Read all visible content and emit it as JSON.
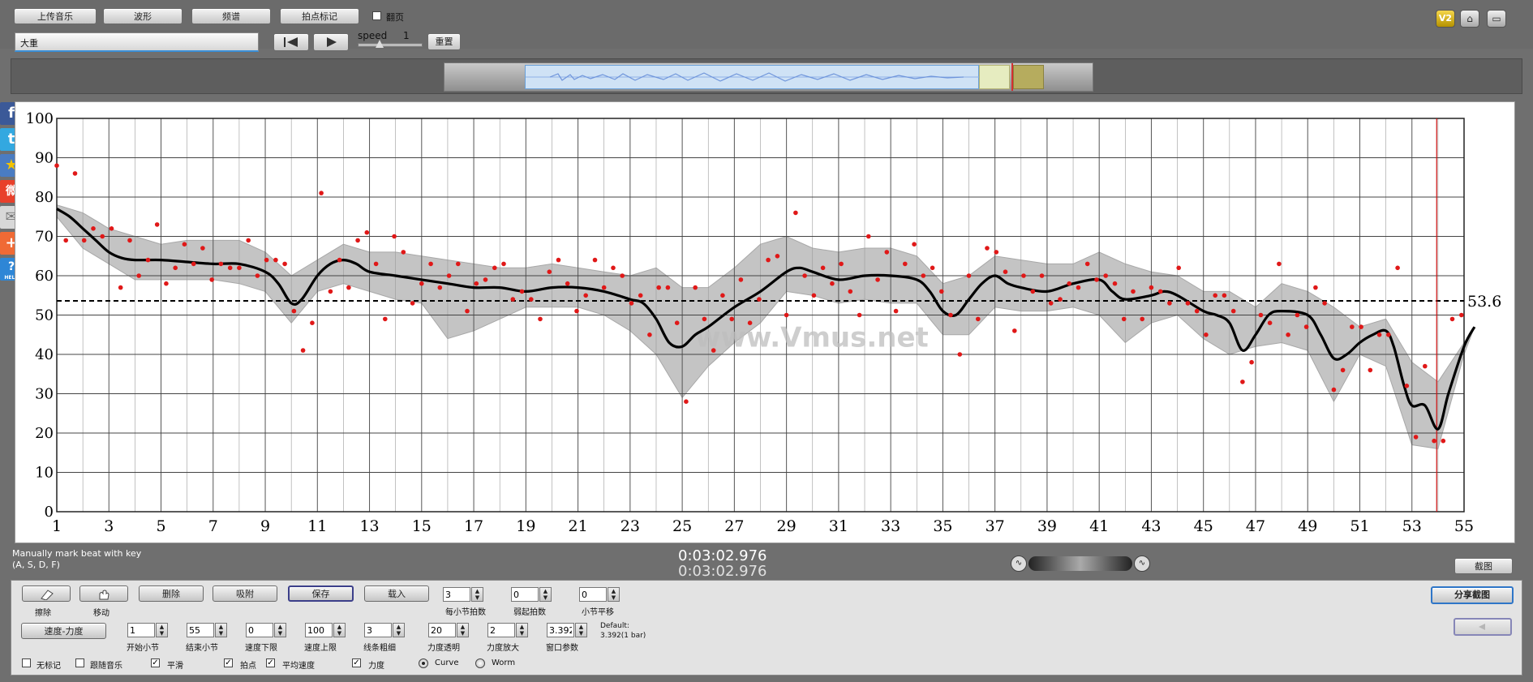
{
  "toolbar": {
    "upload": "上传音乐",
    "waveform": "波形",
    "spectrum": "频谱",
    "beat_mark": "拍点标记",
    "flip_page": "翻页",
    "song_title": "大重",
    "speed_label": "speed",
    "speed_value": "1",
    "reset": "重置"
  },
  "top_icons": [
    "v2-icon",
    "home-icon",
    "window-icon"
  ],
  "chart_data": {
    "type": "scatter",
    "xlim": [
      1,
      55
    ],
    "ylim": [
      0,
      100
    ],
    "x_ticks": [
      1,
      3,
      5,
      7,
      9,
      11,
      13,
      15,
      17,
      19,
      21,
      23,
      25,
      27,
      29,
      31,
      33,
      35,
      37,
      39,
      41,
      43,
      45,
      47,
      49,
      51,
      53,
      55
    ],
    "y_ticks": [
      0,
      10,
      20,
      30,
      40,
      50,
      60,
      70,
      80,
      90,
      100
    ],
    "average": 53.6,
    "average_label": "53.6",
    "cursor_x": 53.95,
    "watermark": "www.Vmus.net",
    "points": [
      [
        1,
        88
      ],
      [
        1.35,
        69
      ],
      [
        1.7,
        86
      ],
      [
        2.05,
        69
      ],
      [
        2.4,
        72
      ],
      [
        2.75,
        70
      ],
      [
        3.1,
        72
      ],
      [
        3.45,
        57
      ],
      [
        3.8,
        69
      ],
      [
        4.15,
        60
      ],
      [
        4.5,
        64
      ],
      [
        4.85,
        73
      ],
      [
        5.2,
        58
      ],
      [
        5.55,
        62
      ],
      [
        5.9,
        68
      ],
      [
        6.25,
        63
      ],
      [
        6.6,
        67
      ],
      [
        6.95,
        59
      ],
      [
        7.3,
        63
      ],
      [
        7.65,
        62
      ],
      [
        8.0,
        62
      ],
      [
        8.35,
        69
      ],
      [
        8.7,
        60
      ],
      [
        9.05,
        64
      ],
      [
        9.4,
        64
      ],
      [
        9.75,
        63
      ],
      [
        10.1,
        51
      ],
      [
        10.45,
        41
      ],
      [
        10.8,
        48
      ],
      [
        11.15,
        81
      ],
      [
        11.5,
        56
      ],
      [
        11.85,
        64
      ],
      [
        12.2,
        57
      ],
      [
        12.55,
        69
      ],
      [
        12.9,
        71
      ],
      [
        13.25,
        63
      ],
      [
        13.6,
        49
      ],
      [
        13.95,
        70
      ],
      [
        14.3,
        66
      ],
      [
        14.65,
        53
      ],
      [
        15.0,
        58
      ],
      [
        15.35,
        63
      ],
      [
        15.7,
        57
      ],
      [
        16.05,
        60
      ],
      [
        16.4,
        63
      ],
      [
        16.75,
        51
      ],
      [
        17.1,
        58
      ],
      [
        17.45,
        59
      ],
      [
        17.8,
        62
      ],
      [
        18.15,
        63
      ],
      [
        18.5,
        54
      ],
      [
        18.85,
        56
      ],
      [
        19.2,
        54
      ],
      [
        19.55,
        49
      ],
      [
        19.9,
        61
      ],
      [
        20.25,
        64
      ],
      [
        20.6,
        58
      ],
      [
        20.95,
        51
      ],
      [
        21.3,
        55
      ],
      [
        21.65,
        64
      ],
      [
        22.0,
        57
      ],
      [
        22.35,
        62
      ],
      [
        22.7,
        60
      ],
      [
        23.05,
        53
      ],
      [
        23.4,
        55
      ],
      [
        23.75,
        45
      ],
      [
        24.1,
        57
      ],
      [
        24.45,
        57
      ],
      [
        24.8,
        48
      ],
      [
        25.15,
        28
      ],
      [
        25.5,
        57
      ],
      [
        25.85,
        49
      ],
      [
        26.2,
        41
      ],
      [
        26.55,
        55
      ],
      [
        26.9,
        49
      ],
      [
        27.25,
        59
      ],
      [
        27.6,
        48
      ],
      [
        27.95,
        54
      ],
      [
        28.3,
        64
      ],
      [
        28.65,
        65
      ],
      [
        29.0,
        50
      ],
      [
        29.35,
        76
      ],
      [
        29.7,
        60
      ],
      [
        30.05,
        55
      ],
      [
        30.4,
        62
      ],
      [
        30.75,
        58
      ],
      [
        31.1,
        63
      ],
      [
        31.45,
        56
      ],
      [
        31.8,
        50
      ],
      [
        32.15,
        70
      ],
      [
        32.5,
        59
      ],
      [
        32.85,
        66
      ],
      [
        33.2,
        51
      ],
      [
        33.55,
        63
      ],
      [
        33.9,
        68
      ],
      [
        34.25,
        60
      ],
      [
        34.6,
        62
      ],
      [
        34.95,
        56
      ],
      [
        35.3,
        50
      ],
      [
        35.65,
        40
      ],
      [
        36.0,
        60
      ],
      [
        36.35,
        49
      ],
      [
        36.7,
        67
      ],
      [
        37.05,
        66
      ],
      [
        37.4,
        61
      ],
      [
        37.75,
        46
      ],
      [
        38.1,
        60
      ],
      [
        38.45,
        56
      ],
      [
        38.8,
        60
      ],
      [
        39.15,
        53
      ],
      [
        39.5,
        54
      ],
      [
        39.85,
        58
      ],
      [
        40.2,
        57
      ],
      [
        40.55,
        63
      ],
      [
        40.9,
        59
      ],
      [
        41.25,
        60
      ],
      [
        41.6,
        58
      ],
      [
        41.95,
        49
      ],
      [
        42.3,
        56
      ],
      [
        42.65,
        49
      ],
      [
        43.0,
        57
      ],
      [
        43.35,
        56
      ],
      [
        43.7,
        53
      ],
      [
        44.05,
        62
      ],
      [
        44.4,
        53
      ],
      [
        44.75,
        51
      ],
      [
        45.1,
        45
      ],
      [
        45.45,
        55
      ],
      [
        45.8,
        55
      ],
      [
        46.15,
        51
      ],
      [
        46.5,
        33
      ],
      [
        46.85,
        38
      ],
      [
        47.2,
        50
      ],
      [
        47.55,
        48
      ],
      [
        47.9,
        63
      ],
      [
        48.25,
        45
      ],
      [
        48.6,
        50
      ],
      [
        48.95,
        47
      ],
      [
        49.3,
        57
      ],
      [
        49.65,
        53
      ],
      [
        50.0,
        31
      ],
      [
        50.35,
        36
      ],
      [
        50.7,
        47
      ],
      [
        51.05,
        47
      ],
      [
        51.4,
        36
      ],
      [
        51.75,
        45
      ],
      [
        52.1,
        45
      ],
      [
        52.45,
        62
      ],
      [
        52.8,
        32
      ],
      [
        53.15,
        19
      ],
      [
        53.5,
        37
      ],
      [
        53.85,
        18
      ],
      [
        54.2,
        18
      ],
      [
        54.55,
        49
      ],
      [
        54.9,
        50
      ]
    ],
    "smooth_curve": [
      [
        1,
        77
      ],
      [
        1.5,
        75
      ],
      [
        2,
        72
      ],
      [
        2.5,
        69
      ],
      [
        3,
        66
      ],
      [
        3.5,
        64.5
      ],
      [
        4,
        64
      ],
      [
        5,
        64
      ],
      [
        6,
        63.5
      ],
      [
        7,
        63
      ],
      [
        8,
        63
      ],
      [
        9,
        61
      ],
      [
        9.5,
        58
      ],
      [
        10,
        53
      ],
      [
        10.4,
        54
      ],
      [
        11,
        60
      ],
      [
        11.5,
        63
      ],
      [
        12,
        64
      ],
      [
        12.5,
        63
      ],
      [
        13,
        61
      ],
      [
        14,
        60
      ],
      [
        15,
        59
      ],
      [
        16,
        58
      ],
      [
        17,
        57
      ],
      [
        18,
        57
      ],
      [
        19,
        56
      ],
      [
        20,
        57
      ],
      [
        21,
        57
      ],
      [
        22,
        56
      ],
      [
        23,
        54
      ],
      [
        23.5,
        53
      ],
      [
        24,
        49
      ],
      [
        24.5,
        43
      ],
      [
        25,
        42
      ],
      [
        25.5,
        45
      ],
      [
        26,
        47
      ],
      [
        27,
        52
      ],
      [
        28,
        56
      ],
      [
        29,
        61
      ],
      [
        29.5,
        62
      ],
      [
        30,
        61
      ],
      [
        31,
        59
      ],
      [
        32,
        60
      ],
      [
        33,
        60
      ],
      [
        34,
        59
      ],
      [
        34.5,
        56
      ],
      [
        35,
        51
      ],
      [
        35.5,
        50
      ],
      [
        36,
        54
      ],
      [
        36.5,
        58
      ],
      [
        37,
        60
      ],
      [
        37.5,
        58
      ],
      [
        38,
        57
      ],
      [
        39,
        56
      ],
      [
        40,
        58
      ],
      [
        41,
        59
      ],
      [
        41.5,
        56
      ],
      [
        42,
        54
      ],
      [
        43,
        55
      ],
      [
        43.5,
        56
      ],
      [
        44,
        55
      ],
      [
        45,
        51
      ],
      [
        45.5,
        50
      ],
      [
        46,
        48
      ],
      [
        46.5,
        41
      ],
      [
        47,
        45
      ],
      [
        47.5,
        50
      ],
      [
        48,
        51
      ],
      [
        49,
        50
      ],
      [
        49.5,
        45
      ],
      [
        50,
        39
      ],
      [
        50.5,
        40
      ],
      [
        51,
        43
      ],
      [
        51.5,
        45
      ],
      [
        52,
        46
      ],
      [
        52.3,
        42
      ],
      [
        52.7,
        32
      ],
      [
        53,
        27
      ],
      [
        53.5,
        27
      ],
      [
        54,
        21
      ],
      [
        54.4,
        30
      ],
      [
        55,
        42
      ],
      [
        55.4,
        47
      ]
    ],
    "band_upper": [
      [
        1,
        78
      ],
      [
        2,
        76
      ],
      [
        3,
        72
      ],
      [
        4,
        70
      ],
      [
        5,
        68
      ],
      [
        6,
        69
      ],
      [
        7,
        69
      ],
      [
        8,
        69
      ],
      [
        9,
        66
      ],
      [
        10,
        60
      ],
      [
        11,
        64
      ],
      [
        12,
        68
      ],
      [
        13,
        66
      ],
      [
        14,
        66
      ],
      [
        15,
        65
      ],
      [
        16,
        64
      ],
      [
        17,
        63
      ],
      [
        18,
        62
      ],
      [
        19,
        62
      ],
      [
        20,
        63
      ],
      [
        21,
        62
      ],
      [
        22,
        61
      ],
      [
        23,
        60
      ],
      [
        24,
        62
      ],
      [
        25,
        57
      ],
      [
        26,
        57
      ],
      [
        27,
        62
      ],
      [
        28,
        68
      ],
      [
        29,
        70
      ],
      [
        30,
        67
      ],
      [
        31,
        66
      ],
      [
        32,
        67
      ],
      [
        33,
        67
      ],
      [
        34,
        65
      ],
      [
        35,
        58
      ],
      [
        36,
        60
      ],
      [
        37,
        65
      ],
      [
        38,
        64
      ],
      [
        39,
        63
      ],
      [
        40,
        63
      ],
      [
        41,
        66
      ],
      [
        42,
        63
      ],
      [
        43,
        61
      ],
      [
        44,
        60
      ],
      [
        45,
        56
      ],
      [
        46,
        56
      ],
      [
        47,
        52
      ],
      [
        48,
        58
      ],
      [
        49,
        56
      ],
      [
        50,
        52
      ],
      [
        51,
        47
      ],
      [
        52,
        49
      ],
      [
        53,
        38
      ],
      [
        54,
        33
      ],
      [
        55,
        43
      ],
      [
        55.4,
        47
      ]
    ],
    "band_lower": [
      [
        55.4,
        47
      ],
      [
        55,
        40
      ],
      [
        54,
        16
      ],
      [
        53,
        17
      ],
      [
        52,
        37
      ],
      [
        51,
        40
      ],
      [
        50,
        28
      ],
      [
        49,
        41
      ],
      [
        48,
        43
      ],
      [
        47,
        42
      ],
      [
        46,
        40
      ],
      [
        45,
        44
      ],
      [
        44,
        50
      ],
      [
        43,
        48
      ],
      [
        42,
        43
      ],
      [
        41,
        50
      ],
      [
        40,
        52
      ],
      [
        39,
        51
      ],
      [
        38,
        51
      ],
      [
        37,
        52
      ],
      [
        36,
        45
      ],
      [
        35,
        45
      ],
      [
        34,
        53
      ],
      [
        33,
        53
      ],
      [
        32,
        54
      ],
      [
        31,
        53
      ],
      [
        30,
        55
      ],
      [
        29,
        56
      ],
      [
        28,
        48
      ],
      [
        27,
        43
      ],
      [
        26,
        37
      ],
      [
        25,
        29
      ],
      [
        24,
        40
      ],
      [
        23,
        46
      ],
      [
        22,
        50
      ],
      [
        21,
        52
      ],
      [
        20,
        52
      ],
      [
        19,
        52
      ],
      [
        18,
        49
      ],
      [
        17,
        46
      ],
      [
        16,
        44
      ],
      [
        15,
        53
      ],
      [
        14,
        54
      ],
      [
        13,
        56
      ],
      [
        12,
        58
      ],
      [
        11,
        56
      ],
      [
        10,
        48
      ],
      [
        9,
        56
      ],
      [
        8,
        58
      ],
      [
        7,
        59
      ],
      [
        6,
        59
      ],
      [
        5,
        59
      ],
      [
        4,
        59
      ],
      [
        3,
        63
      ],
      [
        2,
        67
      ],
      [
        1,
        75
      ]
    ]
  },
  "status": {
    "hint_line1": "Manually mark beat with key",
    "hint_line2": "(A, S, D, F)",
    "time_main": "0:03:02.976",
    "time_sub": "0:03:02.976",
    "screenshot": "截图"
  },
  "tools": {
    "erase_caption": "擦除",
    "move_caption": "移动",
    "delete": "删除",
    "snap": "吸附",
    "save": "保存",
    "load": "载入",
    "tempo_dynamics": "速度-力度"
  },
  "settings_row1": [
    {
      "value": "3",
      "caption": "每小节拍数"
    },
    {
      "value": "0",
      "caption": "弱起拍数"
    },
    {
      "value": "0",
      "caption": "小节平移"
    }
  ],
  "settings_row2": [
    {
      "value": "1",
      "caption": "开始小节"
    },
    {
      "value": "55",
      "caption": "结束小节"
    },
    {
      "value": "0",
      "caption": "速度下限"
    },
    {
      "value": "100",
      "caption": "速度上限"
    },
    {
      "value": "3",
      "caption": "线条粗细"
    },
    {
      "value": "20",
      "caption": "力度透明"
    },
    {
      "value": "2",
      "caption": "力度放大"
    },
    {
      "value": "3.392",
      "caption": "窗口参数"
    }
  ],
  "default_note": {
    "line1": "Default:",
    "line2": "3.392(1 bar)"
  },
  "options": {
    "no_mark": "无标记",
    "follow_music": "跟随音乐",
    "smooth": "平滑",
    "beat_point": "拍点",
    "avg_speed": "平均速度",
    "dynamics": "力度",
    "curve": "Curve",
    "worm": "Worm"
  },
  "share": {
    "share_screenshot": "分享截图"
  }
}
